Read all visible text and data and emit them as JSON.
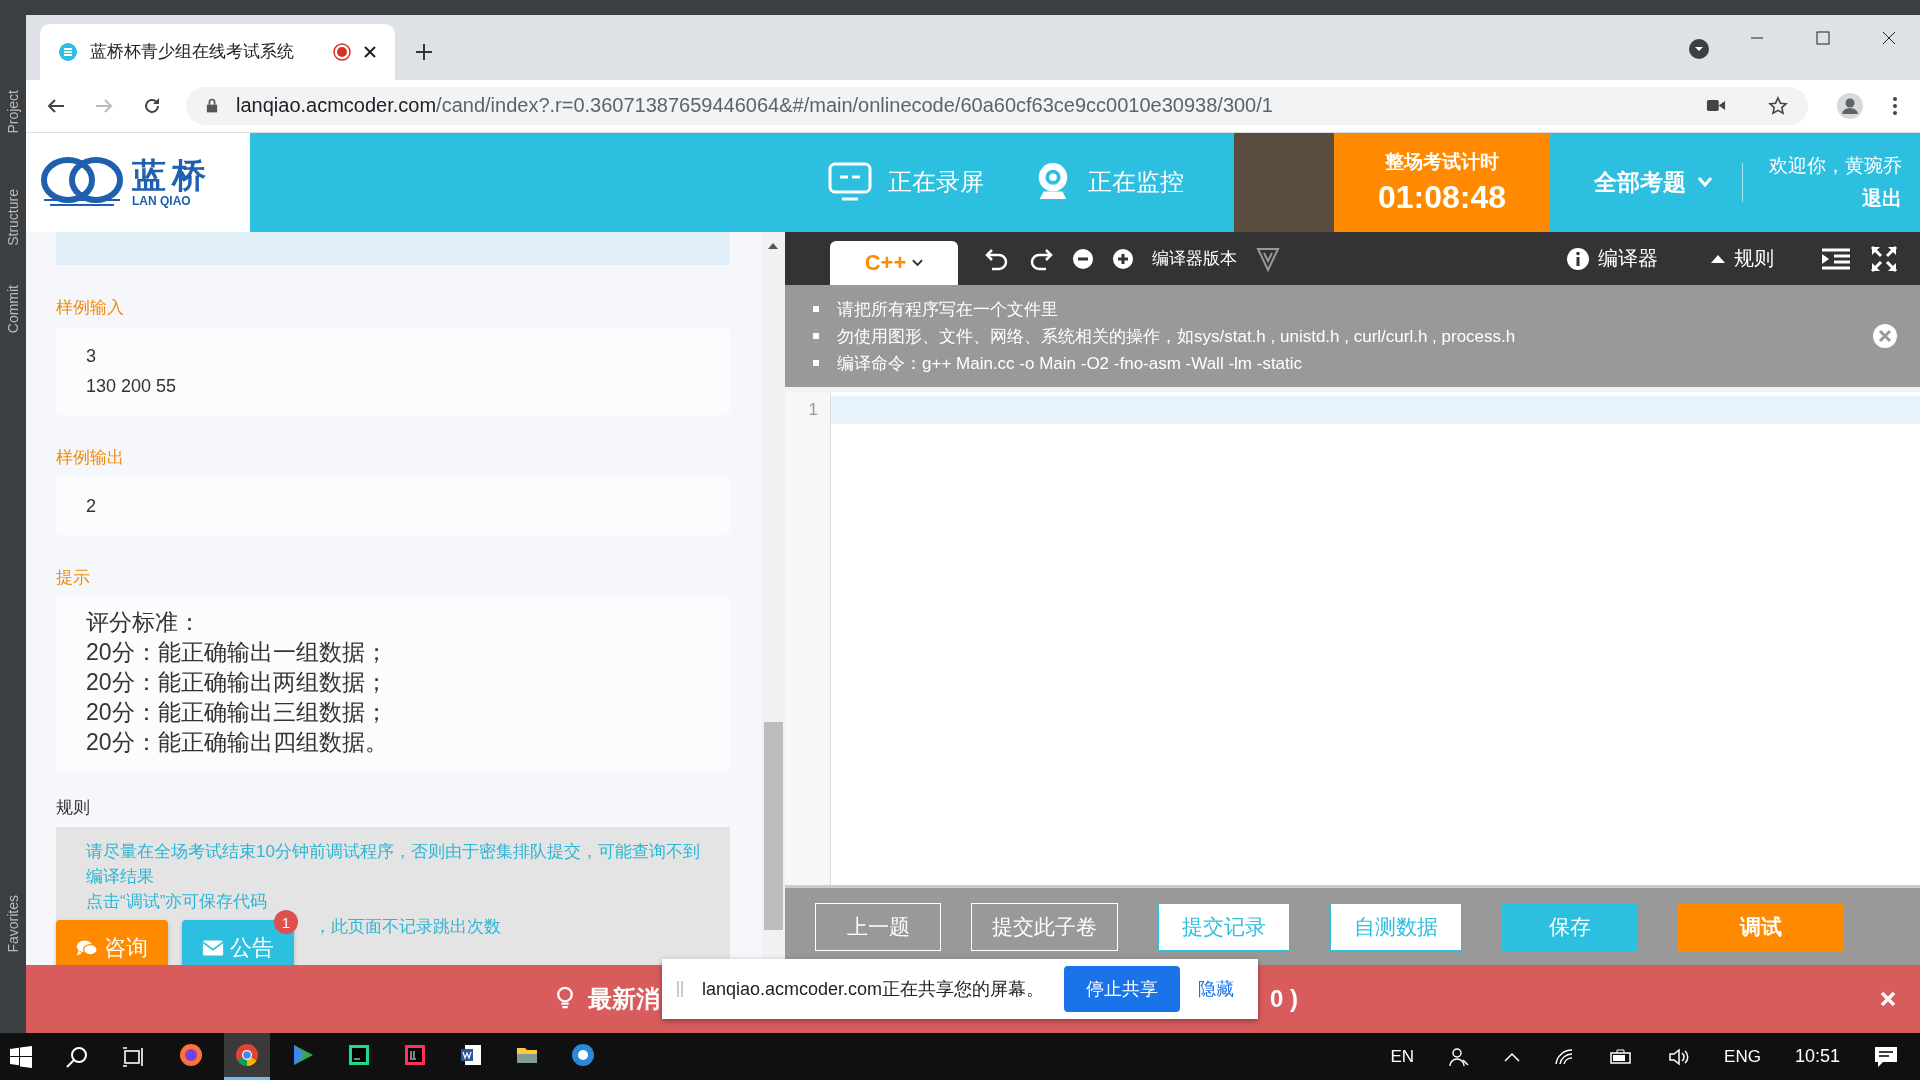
{
  "ide_strip": {
    "tabs": [
      "Project",
      "Structure",
      "Commit",
      "Favorites"
    ]
  },
  "browser": {
    "tabs": [
      {
        "title": "蓝桥杯青少组在线考试系统",
        "selected": true,
        "recording": true
      }
    ],
    "url_host": "lanqiao.acmcoder.com",
    "url_path": "/cand/index?.r=0.36071387659446064&#/main/onlinecode/60a60cf63ce9cc0010e30938/300/1"
  },
  "header": {
    "logo_text": "蓝桥",
    "logo_subtext": "LAN QIAO",
    "recording": "正在录屏",
    "monitoring": "正在监控",
    "timer": {
      "label": "整场考试计时",
      "value": "01:08:48"
    },
    "questions_menu": "全部考题",
    "welcome": "欢迎你，黄琬乔",
    "logout": "退出"
  },
  "problem": {
    "sections": [
      {
        "kind": "sample",
        "title": "样例输入",
        "lines": [
          "3",
          "130 200 55"
        ]
      },
      {
        "kind": "sample",
        "title": "样例输出",
        "lines": [
          "2"
        ]
      },
      {
        "kind": "hint",
        "title": "提示",
        "lines": [
          "评分标准：",
          "20分：能正确输出一组数据；",
          "20分：能正确输出两组数据；",
          "20分：能正确输出三组数据；",
          "20分：能正确输出四组数据。"
        ]
      },
      {
        "kind": "rules",
        "title": "规则",
        "lines": [
          "请尽量在全场考试结束10分钟前调试程序，否则由于密集排队提交，可能查询不到编译结果",
          "点击“调试”亦可保存代码",
          "，此页面不记录跳出次数"
        ]
      }
    ]
  },
  "editor": {
    "language": "C++",
    "compiler_version": "编译器版本",
    "compiler": "编译器",
    "rules": "规则",
    "notices": [
      "请把所有程序写在一个文件里",
      "勿使用图形、文件、网络、系统相关的操作，如sys/stat.h , unistd.h , curl/curl.h , process.h",
      "编译命令：g++ Main.cc -o Main -O2 -fno-asm -Wall -lm -static"
    ],
    "line_numbers": [
      "1"
    ]
  },
  "actions": [
    {
      "label": "上一题",
      "kind": "plain"
    },
    {
      "label": "提交此子卷",
      "kind": "plain"
    },
    {
      "label": "提交记录",
      "kind": "outline"
    },
    {
      "label": "自测数据",
      "kind": "outline"
    },
    {
      "label": "保存",
      "kind": "primary"
    },
    {
      "label": "调试",
      "kind": "accent"
    }
  ],
  "floating": [
    {
      "label": "咨询",
      "kind": "chat"
    },
    {
      "label": "公告",
      "kind": "mail",
      "badge": "1"
    }
  ],
  "banner": {
    "text_start": "最新消",
    "text_end": "0 )"
  },
  "share_popup": {
    "message": "lanqiao.acmcoder.com正在共享您的屏幕。",
    "stop": "停止共享",
    "hide": "隐藏"
  },
  "taskbar": {
    "apps": [
      {
        "kind": "firefox",
        "selected": false
      },
      {
        "kind": "chrome",
        "selected": true
      },
      {
        "kind": "play",
        "selected": false
      },
      {
        "kind": "ide",
        "selected": false
      },
      {
        "kind": "ide2",
        "selected": false
      },
      {
        "kind": "word",
        "selected": false
      },
      {
        "kind": "folder",
        "selected": false
      },
      {
        "kind": "circle",
        "selected": false
      }
    ],
    "input_indicator": "EN",
    "language": "ENG",
    "time": "10:51"
  }
}
